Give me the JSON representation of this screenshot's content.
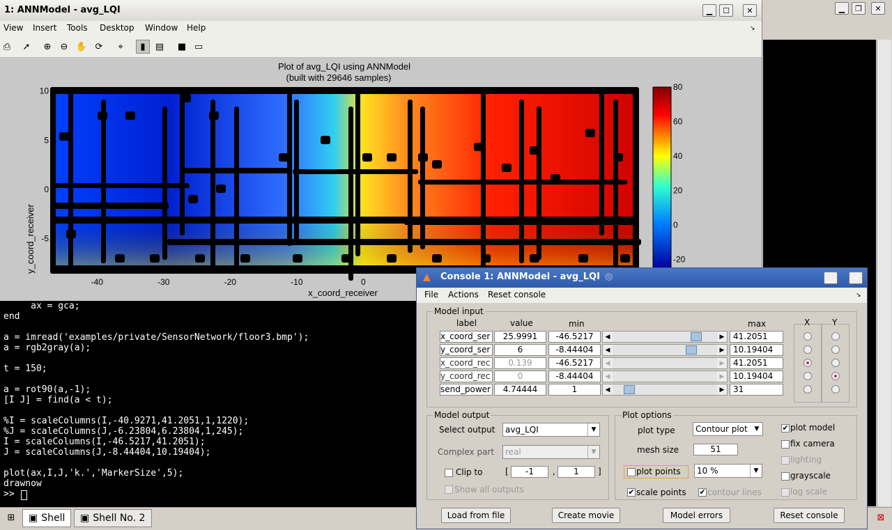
{
  "figure": {
    "title": "1: ANNModel - avg_LQI",
    "menu": [
      "View",
      "Insert",
      "Tools",
      "Desktop",
      "Window",
      "Help"
    ]
  },
  "chart_data": {
    "type": "heatmap",
    "title": "Plot of avg_LQI using ANNModel",
    "subtitle": "(built with 29646 samples)",
    "xlabel": "x_coord_receiver",
    "ylabel": "y_coord_receiver",
    "xlim": [
      -46.52,
      41.21
    ],
    "ylim": [
      -8.44,
      10.19
    ],
    "x_ticks": [
      "-40",
      "-30",
      "-20",
      "-10",
      "0"
    ],
    "y_ticks": [
      "10",
      "5",
      "0",
      "-5"
    ],
    "colorbar_ticks": [
      "80",
      "60",
      "40",
      "20",
      "0",
      "-20"
    ],
    "colorbar_range": [
      -25,
      80
    ],
    "colors": {
      "low": "#0000c8",
      "high": "#8b0000"
    }
  },
  "shell": {
    "lines": [
      "     ax = gca;",
      "end",
      "",
      "a = imread('examples/private/SensorNetwork/floor3.bmp');",
      "a = rgb2gray(a);",
      "",
      "t = 150;",
      "",
      "a = rot90(a,-1);",
      "[I J] = find(a < t);",
      "",
      "%I = scaleColumns(I,-40.9271,41.2051,1,1220);",
      "%J = scaleColumns(J,-6.23804,6.23804,1,245);",
      "I = scaleColumns(I,-46.5217,41.2051);",
      "J = scaleColumns(J,-8.44404,10.19404);",
      "",
      "plot(ax,I,J,'k.','MarkerSize',5);",
      "drawnow",
      ">> "
    ]
  },
  "taskbar": {
    "shell1": "Shell",
    "shell2": "Shell No. 2"
  },
  "console": {
    "title": "Console 1: ANNModel - avg_LQI",
    "menu": [
      "File",
      "Actions",
      "Reset console"
    ],
    "model_input": {
      "label": "Model input",
      "headers": {
        "label": "label",
        "value": "value",
        "min": "min",
        "max": "max",
        "x": "X",
        "y": "Y"
      },
      "rows": [
        {
          "label": "x_coord_ser",
          "value": "25.9991",
          "min": "-46.5217",
          "max": "41.2051",
          "slider": 0.82,
          "active": true
        },
        {
          "label": "y_coord_ser",
          "value": "6",
          "min": "-8.44404",
          "max": "10.19404",
          "slider": 0.77,
          "active": true
        },
        {
          "label": "x_coord_rec",
          "value": "0.139",
          "min": "-46.5217",
          "max": "41.2051",
          "slider": 0,
          "active": false
        },
        {
          "label": "y_coord_rec",
          "value": "0",
          "min": "-8.44404",
          "max": "10.19404",
          "slider": 0,
          "active": false
        },
        {
          "label": "send_power",
          "value": "4.74444",
          "min": "1",
          "max": "31",
          "slider": 0.12,
          "active": true
        }
      ],
      "x_selected": 2,
      "y_selected": 3
    },
    "model_output": {
      "label": "Model output",
      "select_output_label": "Select output",
      "select_output_value": "avg_LQI",
      "complex_part_label": "Complex part",
      "complex_part_value": "real",
      "clip_to_label": "Clip to",
      "clip_min": "-1",
      "clip_max": "1",
      "show_all_label": "Show all outputs"
    },
    "plot_options": {
      "label": "Plot options",
      "plot_type_label": "plot type",
      "plot_type_value": "Contour plot",
      "mesh_size_label": "mesh size",
      "mesh_size_value": "51",
      "plot_points_label": "plot points",
      "plot_points_value": "10 %",
      "scale_points_label": "scale points",
      "contour_lines_label": "contour lines",
      "checks": [
        {
          "label": "plot model",
          "checked": true,
          "enabled": true
        },
        {
          "label": "fix camera",
          "checked": false,
          "enabled": true
        },
        {
          "label": "lighting",
          "checked": false,
          "enabled": false
        },
        {
          "label": "grayscale",
          "checked": false,
          "enabled": true
        },
        {
          "label": "log scale",
          "checked": false,
          "enabled": false
        }
      ]
    },
    "buttons": {
      "load": "Load from file",
      "movie": "Create movie",
      "errors": "Model errors",
      "reset": "Reset console"
    }
  }
}
